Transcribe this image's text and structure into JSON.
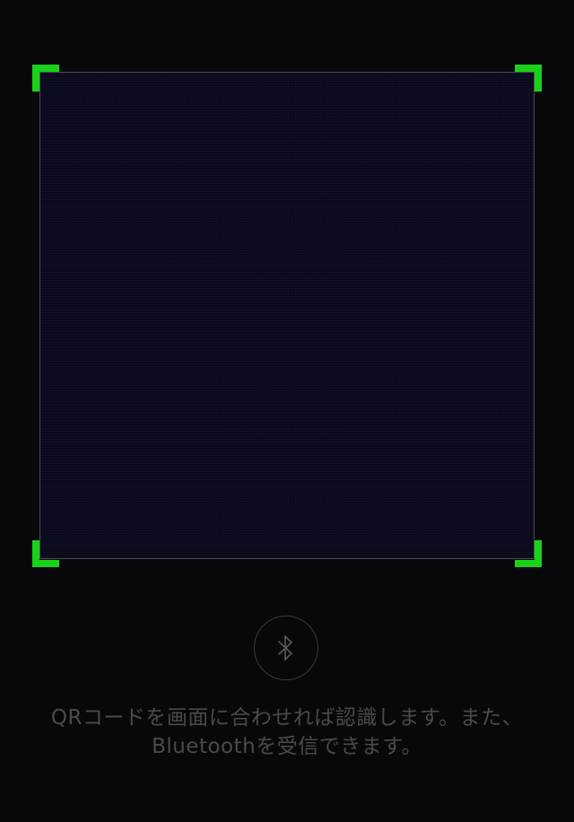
{
  "scanner": {
    "frame_border_color": "#4a4a5a",
    "corner_color": "#18d318"
  },
  "bluetooth": {
    "icon": "bluetooth-icon"
  },
  "instruction": {
    "text": "QRコードを画面に合わせれば認識します。また、Bluetoothを受信できます。"
  }
}
